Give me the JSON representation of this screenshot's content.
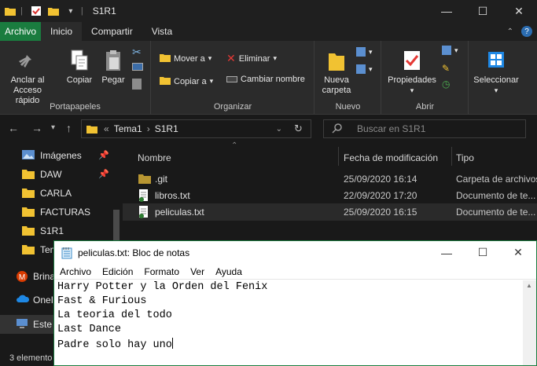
{
  "window": {
    "title": "S1R1",
    "minimize": "—",
    "maximize": "☐",
    "close": "✕"
  },
  "ribbon_tabs": [
    "Archivo",
    "Inicio",
    "Compartir",
    "Vista"
  ],
  "ribbon": {
    "portapapeles": {
      "label": "Portapapeles",
      "anclar_line1": "Anclar al",
      "anclar_line2": "Acceso rápido",
      "copiar": "Copiar",
      "pegar": "Pegar"
    },
    "organizar": {
      "label": "Organizar",
      "mover_a": "Mover a",
      "copiar_a": "Copiar a",
      "eliminar": "Eliminar",
      "cambiar_nombre": "Cambiar nombre"
    },
    "nuevo": {
      "label": "Nuevo",
      "nueva_line1": "Nueva",
      "nueva_line2": "carpeta"
    },
    "abrir": {
      "label": "Abrir",
      "propiedades": "Propiedades"
    },
    "seleccionar": {
      "label": "Seleccionar"
    }
  },
  "address": {
    "prefix": "«",
    "crumbs": [
      "Tema1",
      "S1R1"
    ],
    "search_placeholder": "Buscar en S1R1"
  },
  "nav_pane": [
    {
      "label": "Imágenes",
      "icon": "images-icon",
      "pinned": true
    },
    {
      "label": "DAW",
      "icon": "folder-icon",
      "pinned": true
    },
    {
      "label": "CARLA",
      "icon": "folder-icon",
      "pinned": false
    },
    {
      "label": "FACTURAS",
      "icon": "folder-icon",
      "pinned": false
    },
    {
      "label": "S1R1",
      "icon": "folder-icon",
      "pinned": false
    },
    {
      "label": "Tem",
      "icon": "folder-icon",
      "pinned": false
    },
    {
      "label": "Brina",
      "icon": "office-icon",
      "pinned": false
    },
    {
      "label": "OneI",
      "icon": "cloud-icon",
      "pinned": false
    },
    {
      "label": "Este",
      "icon": "pc-icon",
      "pinned": false
    }
  ],
  "columns": {
    "name": "Nombre",
    "date": "Fecha de modificación",
    "type": "Tipo"
  },
  "files": [
    {
      "name": ".git",
      "date": "25/09/2020 16:14",
      "type": "Carpeta de archivos",
      "icon": "folder-icon"
    },
    {
      "name": "libros.txt",
      "date": "22/09/2020 17:20",
      "type": "Documento de te...",
      "icon": "txt-file-icon"
    },
    {
      "name": "peliculas.txt",
      "date": "25/09/2020 16:15",
      "type": "Documento de te...",
      "icon": "txt-file-icon"
    }
  ],
  "status": {
    "count": "3 elemento"
  },
  "notepad": {
    "title": "peliculas.txt: Bloc de notas",
    "menu": [
      "Archivo",
      "Edición",
      "Formato",
      "Ver",
      "Ayuda"
    ],
    "lines": [
      "Harry Potter y la Orden del Fenix",
      "Fast & Furious",
      "La teoria del todo",
      "Last Dance",
      "Padre solo hay uno"
    ]
  },
  "colors": {
    "accent": "#1a7c3f",
    "background": "#191919",
    "folder": "#f1c232"
  }
}
